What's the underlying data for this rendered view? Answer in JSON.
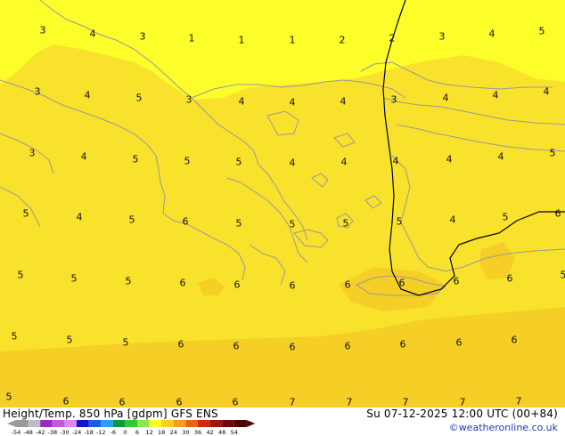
{
  "map": {
    "title": "Height/Temp. 850 hPa [gdpm] GFS ENS",
    "valid_time": "Su 07-12-2025 12:00 UTC (00+84)",
    "credit": "©weatheronline.co.uk",
    "background_colors": {
      "temp_3_4": "#fdfd2a",
      "temp_5_6": "#f9e22c",
      "temp_6_7": "#f5cf26",
      "coastline": "#9a9a9a",
      "contour": "#000000"
    },
    "temperature_labels": [
      {
        "v": "3"
      },
      {
        "v": "4"
      },
      {
        "v": "3"
      },
      {
        "v": "1"
      },
      {
        "v": "1"
      },
      {
        "v": "1"
      },
      {
        "v": "2"
      },
      {
        "v": "2"
      },
      {
        "v": "3"
      },
      {
        "v": "4"
      },
      {
        "v": "5"
      },
      {
        "v": "3"
      },
      {
        "v": "4"
      },
      {
        "v": "5"
      },
      {
        "v": "3"
      },
      {
        "v": "4"
      },
      {
        "v": "4"
      },
      {
        "v": "4"
      },
      {
        "v": "3"
      },
      {
        "v": "4"
      },
      {
        "v": "4"
      },
      {
        "v": "4"
      },
      {
        "v": "3"
      },
      {
        "v": "4"
      },
      {
        "v": "5"
      },
      {
        "v": "5"
      },
      {
        "v": "5"
      },
      {
        "v": "4"
      },
      {
        "v": "4"
      },
      {
        "v": "4"
      },
      {
        "v": "4"
      },
      {
        "v": "4"
      },
      {
        "v": "5"
      },
      {
        "v": "5"
      },
      {
        "v": "4"
      },
      {
        "v": "5"
      },
      {
        "v": "6"
      },
      {
        "v": "5"
      },
      {
        "v": "5"
      },
      {
        "v": "5"
      },
      {
        "v": "5"
      },
      {
        "v": "4"
      },
      {
        "v": "5"
      },
      {
        "v": "6"
      },
      {
        "v": "5"
      },
      {
        "v": "5"
      },
      {
        "v": "5"
      },
      {
        "v": "6"
      },
      {
        "v": "6"
      },
      {
        "v": "6"
      },
      {
        "v": "6"
      },
      {
        "v": "6"
      },
      {
        "v": "6"
      },
      {
        "v": "6"
      },
      {
        "v": "5"
      },
      {
        "v": "5"
      },
      {
        "v": "5"
      },
      {
        "v": "5"
      },
      {
        "v": "6"
      },
      {
        "v": "6"
      },
      {
        "v": "6"
      },
      {
        "v": "6"
      },
      {
        "v": "6"
      },
      {
        "v": "6"
      },
      {
        "v": "6"
      },
      {
        "v": "5"
      },
      {
        "v": "6"
      },
      {
        "v": "6"
      },
      {
        "v": "6"
      },
      {
        "v": "6"
      },
      {
        "v": "7"
      },
      {
        "v": "7"
      },
      {
        "v": "7"
      },
      {
        "v": "7"
      },
      {
        "v": "7"
      }
    ],
    "scale": {
      "labels": [
        "-54",
        "-48",
        "-42",
        "-38",
        "-30",
        "-24",
        "-18",
        "-12",
        "-6",
        "0",
        "6",
        "12",
        "18",
        "24",
        "30",
        "36",
        "42",
        "48",
        "54"
      ],
      "colors": [
        "#9a9a9a",
        "#bdbdbd",
        "#9b2bc0",
        "#c25bd8",
        "#e088ea",
        "#1414c8",
        "#1c5ae8",
        "#2aa0f0",
        "#0a9c3c",
        "#32c832",
        "#8ce650",
        "#fdfd2a",
        "#f5cf26",
        "#f0a01e",
        "#e66414",
        "#d22814",
        "#a01414",
        "#6e0a0a",
        "#4a0505"
      ]
    }
  }
}
